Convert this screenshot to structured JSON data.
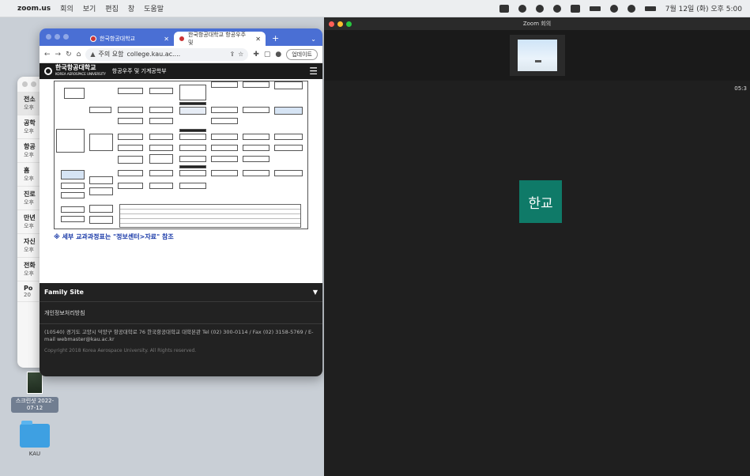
{
  "menubar": {
    "app": "zoom.us",
    "items": [
      "회의",
      "보기",
      "편집",
      "창",
      "도움말"
    ],
    "clock": "7월 12일 (화) 오후 5:00"
  },
  "back_window": {
    "items": [
      {
        "title": "전소",
        "sub": "오후"
      },
      {
        "title": "공학",
        "sub": "오후"
      },
      {
        "title": "항공",
        "sub": "오후"
      },
      {
        "title": "홈",
        "sub": "오후"
      },
      {
        "title": "진로",
        "sub": "오후"
      },
      {
        "title": "만년",
        "sub": "오후"
      },
      {
        "title": "자신",
        "sub": "오후"
      },
      {
        "title": "전화",
        "sub": "오후"
      },
      {
        "title": "Po",
        "sub": "20"
      }
    ]
  },
  "desktop_icons": [
    {
      "label": "스크린샷 2022-07-12"
    },
    {
      "label": "KAU"
    }
  ],
  "browser": {
    "tabs": [
      {
        "label": "한국항공대학교"
      },
      {
        "label": "한국항공대학교 항공우주 및"
      }
    ],
    "new_tab": "+",
    "url_warning": "주의 요함",
    "url": "college.kau.ac....",
    "update_label": "업데이트",
    "site": {
      "university": "한국항공대학교",
      "university_en": "KOREA AEROSPACE UNIVERSITY",
      "department": "항공우주 및 기계공학부"
    },
    "notice": "※ 세부 교과과정표는 \"정보센터>자료\" 참조",
    "footer": {
      "family_site": "Family Site",
      "privacy": "개인정보처리방침",
      "address": "(10540) 경기도 고양시 덕양구 항공대학로 76 한국항공대학교 대학본관 Tel (02) 300-0114 / Fax (02) 3158-5769 / E-mail webmaster@kau.ac.kr",
      "copyright": "Copyright 2018 Korea Aerospace University. All Rights reserved."
    }
  },
  "zoom": {
    "title": "Zoom 회의",
    "timer": "05:3",
    "participant": "한교",
    "colors": {
      "avatar": "#0f7a68"
    }
  }
}
